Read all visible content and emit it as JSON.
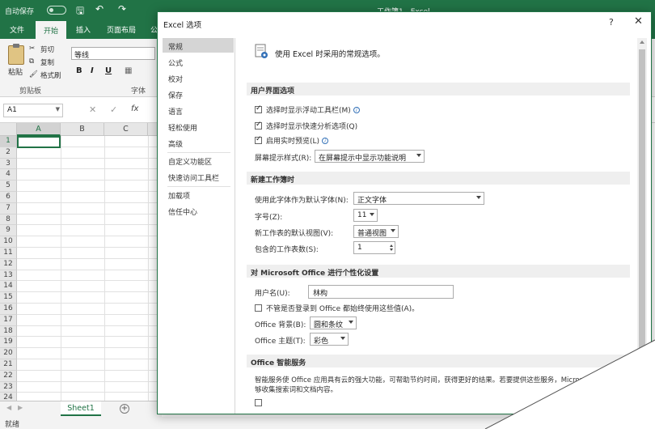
{
  "excel": {
    "autosave": "自动保存",
    "autosave_state": "关",
    "window_title": "工作簿1  -  Excel",
    "tabs": [
      "文件",
      "开始",
      "插入",
      "页面布局",
      "公"
    ],
    "ribbon": {
      "paste": "粘贴",
      "cut": "剪切",
      "copy": "复制",
      "format_painter": "格式刷",
      "clipboard_group": "剪贴板",
      "font_name": "等线",
      "font_group": "字体",
      "bold": "B",
      "italic": "I",
      "underline": "U"
    },
    "name_box": "A1",
    "fx": "fx",
    "columns": [
      "A",
      "B",
      "C"
    ],
    "rows": [
      "1",
      "2",
      "3",
      "4",
      "5",
      "6",
      "7",
      "8",
      "9",
      "10",
      "11",
      "12",
      "13",
      "14",
      "15",
      "16",
      "17",
      "18",
      "19",
      "20",
      "21",
      "22",
      "23",
      "24"
    ],
    "sheet_tab": "Sheet1",
    "add_sheet": "+",
    "status": "就绪"
  },
  "dialog": {
    "title": "Excel 选项",
    "help": "?",
    "close": "✕",
    "nav": [
      "常规",
      "公式",
      "校对",
      "保存",
      "语言",
      "轻松使用",
      "高级",
      "自定义功能区",
      "快速访问工具栏",
      "加载项",
      "信任中心"
    ],
    "header": "使用 Excel 时采用的常规选项。",
    "ui_section": {
      "title": "用户界面选项",
      "mini_toolbar": "选择时显示浮动工具栏(M)",
      "quick_analysis": "选择时显示快速分析选项(Q)",
      "live_preview": "启用实时预览(L)",
      "screentip_label": "屏幕提示样式(R):",
      "screentip_value": "在屏幕提示中显示功能说明"
    },
    "new_wb_section": {
      "title": "新建工作簿时",
      "font_label": "使用此字体作为默认字体(N):",
      "font_value": "正文字体",
      "size_label": "字号(Z):",
      "size_value": "11",
      "view_label": "新工作表的默认视图(V):",
      "view_value": "普通视图",
      "sheets_label": "包含的工作表数(S):",
      "sheets_value": "1"
    },
    "personalize_section": {
      "title": "对 Microsoft Office 进行个性化设置",
      "username_label": "用户名(U):",
      "username_value": "林构",
      "always_use": "不管是否登录到 Office 都始终使用这些值(A)。",
      "bg_label": "Office 背景(B):",
      "bg_value": "圆和条纹",
      "theme_label": "Office 主题(T):",
      "theme_value": "彩色"
    },
    "intelligent_section": {
      "title": "Office 智能服务",
      "desc_line1": "智能服务使 Office 应用具有云的强大功能，可帮助节约时间，获得更好的结果。若要提供这些服务，Microsoft 需",
      "desc_line2": "够收集搜索词和文档内容。"
    }
  },
  "colors": {
    "excel_green": "#217346",
    "nav_selected": "#d5d5d5",
    "section_bg": "#efefef"
  }
}
